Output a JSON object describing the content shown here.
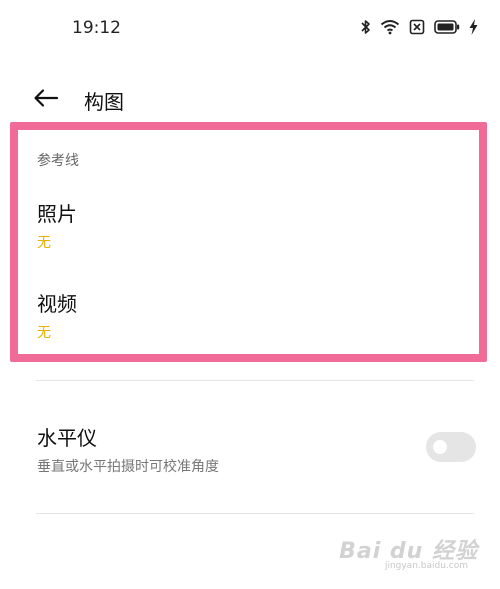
{
  "status_bar": {
    "time": "19:12",
    "icons": [
      "bluetooth-icon",
      "wifi-icon",
      "sim-icon",
      "battery-icon",
      "charging-icon"
    ]
  },
  "header": {
    "back_icon": "arrow-left-icon",
    "title": "构图"
  },
  "guides": {
    "section_label": "参考线",
    "items": [
      {
        "title": "照片",
        "value": "无"
      },
      {
        "title": "视频",
        "value": "无"
      }
    ]
  },
  "level": {
    "title": "水平仪",
    "description": "垂直或水平拍摄时可校准角度",
    "enabled": false
  },
  "colors": {
    "accent_value": "#e8b000",
    "highlight_border": "#f06b97",
    "toggle_off": "#e5e5e5"
  },
  "watermark": {
    "main": "Bai du 经验",
    "sub": "jingyan.baidu.com"
  }
}
